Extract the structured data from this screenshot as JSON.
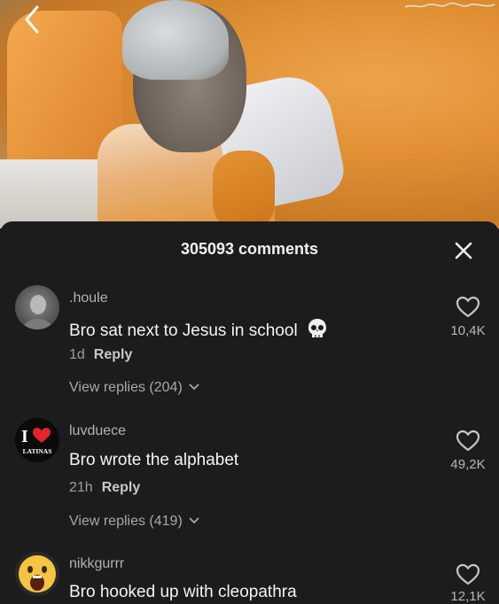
{
  "header": {
    "comments_count_label": "305093 comments",
    "back_icon": "chevron-left-icon",
    "close_icon": "close-icon"
  },
  "comments": [
    {
      "username": ".houle",
      "text": "Bro sat next to Jesus in school",
      "emoji": "skull-emoji",
      "time": "1d",
      "reply_label": "Reply",
      "view_replies": "View replies (204)",
      "likes": "10,4K",
      "avatar": "grayscale-photo-avatar"
    },
    {
      "username": "luvduece",
      "text": "Bro wrote the alphabet",
      "time": "21h",
      "reply_label": "Reply",
      "view_replies": "View replies (419)",
      "likes": "49,2K",
      "avatar": "i-heart-latinas-logo-avatar",
      "avatar_text_top": "I",
      "avatar_text_bottom": "LATINAS"
    },
    {
      "username": "nikkgurrr",
      "text": "Bro hooked up with cleopathra",
      "likes": "12,1K",
      "avatar": "screaming-emoji-avatar"
    }
  ],
  "colors": {
    "sheet_background": "#1c1c1e",
    "primary_text": "#f4f4f4",
    "secondary_text": "#9d9d9d"
  }
}
